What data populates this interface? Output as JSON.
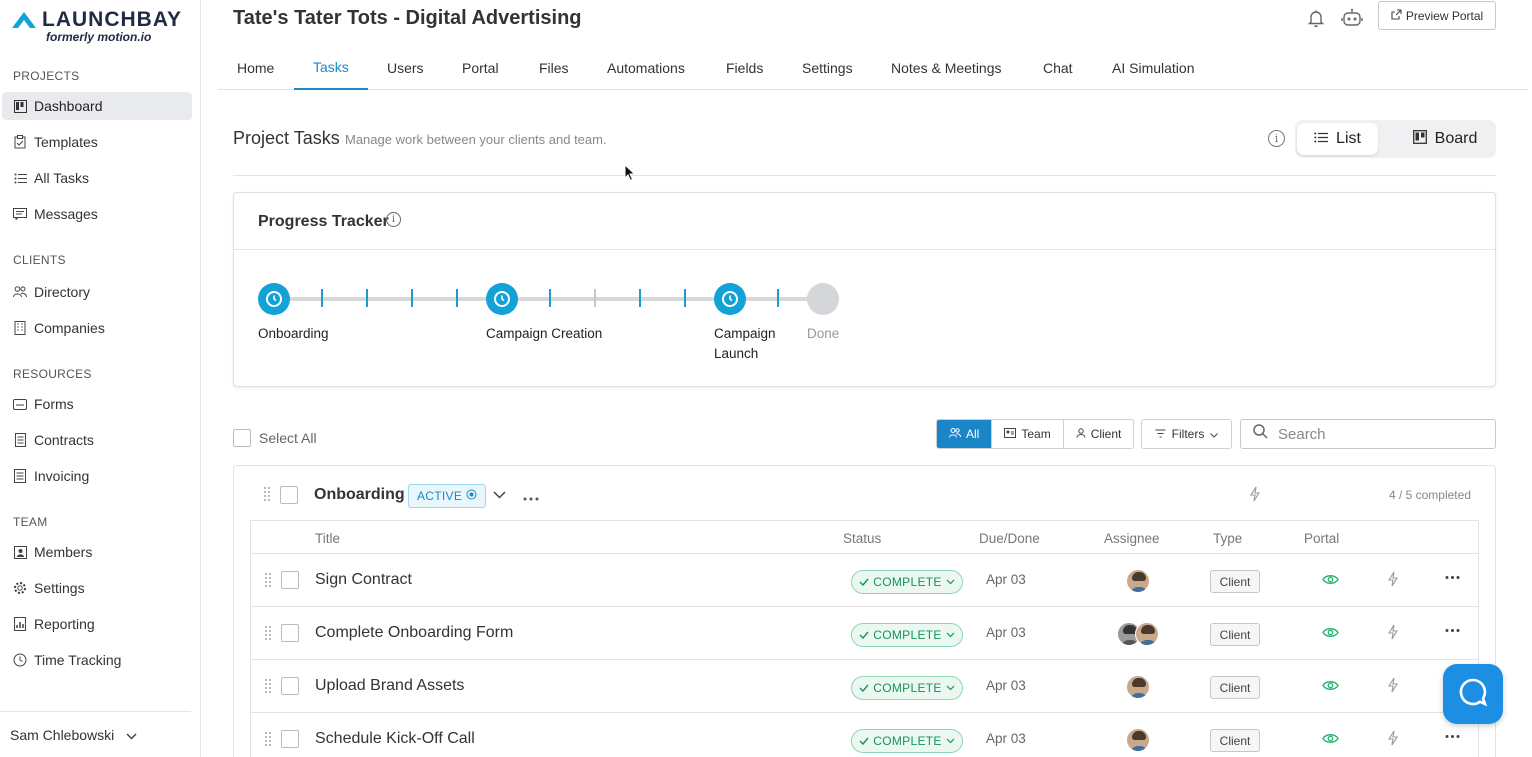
{
  "brand": {
    "name": "LAUNCHBAY",
    "subtitle": "formerly motion.io",
    "accent": "#1a8ac6"
  },
  "sidebar": {
    "sections": [
      {
        "label": "PROJECTS",
        "items": [
          {
            "label": "Dashboard",
            "icon": "board-icon",
            "active": true
          },
          {
            "label": "Templates",
            "icon": "clipboard-icon"
          },
          {
            "label": "All Tasks",
            "icon": "list-icon"
          },
          {
            "label": "Messages",
            "icon": "message-icon"
          }
        ]
      },
      {
        "label": "CLIENTS",
        "items": [
          {
            "label": "Directory",
            "icon": "people-icon"
          },
          {
            "label": "Companies",
            "icon": "building-icon"
          }
        ]
      },
      {
        "label": "RESOURCES",
        "items": [
          {
            "label": "Forms",
            "icon": "form-icon"
          },
          {
            "label": "Contracts",
            "icon": "document-icon"
          },
          {
            "label": "Invoicing",
            "icon": "invoice-icon"
          }
        ]
      },
      {
        "label": "TEAM",
        "items": [
          {
            "label": "Members",
            "icon": "member-icon"
          },
          {
            "label": "Settings",
            "icon": "gear-icon"
          },
          {
            "label": "Reporting",
            "icon": "report-icon"
          },
          {
            "label": "Time Tracking",
            "icon": "clock-icon"
          }
        ]
      }
    ],
    "user": "Sam Chlebowski"
  },
  "header": {
    "title": "Tate's Tater Tots - Digital Advertising",
    "preview_label": "Preview Portal"
  },
  "tabs": [
    "Home",
    "Tasks",
    "Users",
    "Portal",
    "Files",
    "Automations",
    "Fields",
    "Settings",
    "Notes & Meetings",
    "Chat",
    "AI Simulation"
  ],
  "active_tab": "Tasks",
  "project_tasks": {
    "title": "Project Tasks",
    "subtitle": "Manage work between your clients and team.",
    "view_list": "List",
    "view_board": "Board",
    "info_glyph": "i"
  },
  "tracker": {
    "title": "Progress Tracker",
    "milestones": [
      {
        "label": "Onboarding",
        "state": "active"
      },
      {
        "label": "Campaign Creation",
        "state": "active"
      },
      {
        "label": "Campaign Launch",
        "state": "active"
      },
      {
        "label": "Done",
        "state": "pending"
      }
    ]
  },
  "controls": {
    "select_all": "Select All",
    "filter_all": "All",
    "filter_team": "Team",
    "filter_client": "Client",
    "filters_label": "Filters",
    "search_placeholder": "Search"
  },
  "group": {
    "name": "Onboarding",
    "badge": "ACTIVE",
    "completed_text": "4 / 5 completed",
    "columns": {
      "title": "Title",
      "status": "Status",
      "due": "Due/Done",
      "assignee": "Assignee",
      "type": "Type",
      "portal": "Portal"
    },
    "rows": [
      {
        "title": "Sign Contract",
        "status": "COMPLETE",
        "due": "Apr 03",
        "type": "Client",
        "assignees": 1
      },
      {
        "title": "Complete Onboarding Form",
        "status": "COMPLETE",
        "due": "Apr 03",
        "type": "Client",
        "assignees": 2
      },
      {
        "title": "Upload Brand Assets",
        "status": "COMPLETE",
        "due": "Apr 03",
        "type": "Client",
        "assignees": 1
      },
      {
        "title": "Schedule Kick-Off Call",
        "status": "COMPLETE",
        "due": "Apr 03",
        "type": "Client",
        "assignees": 1
      }
    ]
  }
}
